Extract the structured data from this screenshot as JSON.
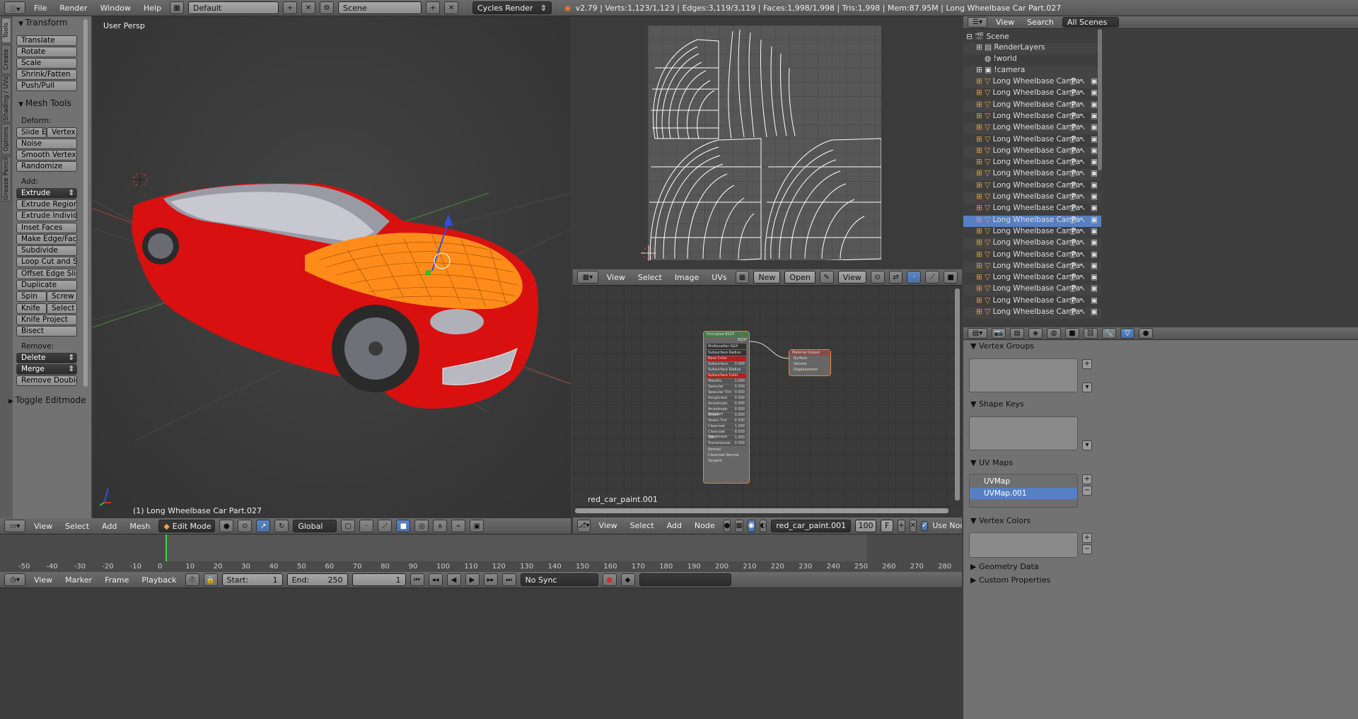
{
  "topbar": {
    "menus": [
      "File",
      "Render",
      "Window",
      "Help"
    ],
    "screen_layout": "Default",
    "scene": "Scene",
    "engine": "Cycles Render",
    "stats": "v2.79 | Verts:1,123/1,123 | Edges:3,119/3,119 | Faces:1,998/1,998 | Tris:1,998 | Mem:87.95M | Long Wheelbase Car Part.027"
  },
  "toolshelf": {
    "tabs": [
      "Tools",
      "Create",
      "Shading / UVs",
      "Options",
      "Grease Pencil"
    ],
    "transform": {
      "title": "Transform",
      "buttons": [
        "Translate",
        "Rotate",
        "Scale",
        "Shrink/Fatten",
        "Push/Pull"
      ]
    },
    "mesh_tools": {
      "title": "Mesh Tools",
      "deform_label": "Deform:",
      "slide_edge": "Slide Ed",
      "vertex": "Vertex",
      "noise": "Noise",
      "smooth_vertex": "Smooth Vertex",
      "randomize": "Randomize",
      "add_label": "Add:",
      "extrude": "Extrude",
      "extrude_region": "Extrude Region",
      "extrude_individual": "Extrude Individual",
      "inset_faces": "Inset Faces",
      "make_edge_face": "Make Edge/Face",
      "subdivide": "Subdivide",
      "loop_cut": "Loop Cut and Slide",
      "offset_edge": "Offset Edge Slide",
      "duplicate": "Duplicate",
      "spin": "Spin",
      "screw": "Screw",
      "knife": "Knife",
      "select": "Select",
      "knife_project": "Knife Project",
      "bisect": "Bisect",
      "remove_label": "Remove:",
      "delete": "Delete",
      "merge": "Merge",
      "remove_doubles": "Remove Doubles"
    },
    "toggle_editmode": "Toggle Editmode"
  },
  "viewport": {
    "label": "User Persp",
    "object_label": "(1) Long Wheelbase Car Part.027",
    "header": {
      "menus": [
        "View",
        "Select",
        "Add",
        "Mesh"
      ],
      "mode": "Edit Mode",
      "orientation": "Global"
    }
  },
  "uv_editor": {
    "header": {
      "menus": [
        "View",
        "Select",
        "Image",
        "UVs"
      ],
      "new": "New",
      "open": "Open",
      "view": "View"
    }
  },
  "node_editor": {
    "material_name": "red_car_paint.001",
    "principled": {
      "title": "Principled BSDF",
      "output": "BSDF",
      "distribution": "Multiscatter GGX",
      "subsurface_method": "Subsurface Radius",
      "fields": [
        [
          "Base Color",
          ""
        ],
        [
          "Subsurface",
          "0.000"
        ],
        [
          "Subsurface Radius",
          ""
        ],
        [
          "Subsurface Color",
          ""
        ],
        [
          "Metallic",
          "1.000"
        ],
        [
          "Specular",
          "0.500"
        ],
        [
          "Specular Tint",
          "0.000"
        ],
        [
          "Roughness",
          "0.500"
        ],
        [
          "Anisotropic",
          "0.000"
        ],
        [
          "Anisotropic Rotation",
          "0.000"
        ],
        [
          "Sheen",
          "0.000"
        ],
        [
          "Sheen Tint",
          "0.500"
        ],
        [
          "Clearcoat",
          "1.000"
        ],
        [
          "Clearcoat Roughness",
          "0.030"
        ],
        [
          "IOR",
          "1.450"
        ],
        [
          "Transmission",
          "0.000"
        ]
      ],
      "inputs": [
        "Normal",
        "Clearcoat Normal",
        "Tangent"
      ]
    },
    "output_node": {
      "title": "Material Output",
      "inputs": [
        "Surface",
        "Volume",
        "Displacement"
      ]
    },
    "header": {
      "menus": [
        "View",
        "Select",
        "Add",
        "Node"
      ],
      "material": "red_car_paint.001",
      "users": "100",
      "fake_user": "F",
      "use_nodes": "Use Nodes"
    }
  },
  "outliner": {
    "header": {
      "view": "View",
      "search": "Search",
      "scope": "All Scenes"
    },
    "scene": "Scene",
    "render_layers": "RenderLayers",
    "world": "!world",
    "camera": "!camera",
    "object_name": "Long Wheelbase Car Pa",
    "object_count": 21,
    "selected_index": 12
  },
  "properties": {
    "vertex_groups": "Vertex Groups",
    "shape_keys": "Shape Keys",
    "uv_maps": "UV Maps",
    "uv_map_items": [
      "UVMap",
      "UVMap.001"
    ],
    "vertex_colors": "Vertex Colors",
    "geometry_data": "Geometry Data",
    "custom_properties": "Custom Properties"
  },
  "timeline": {
    "ticks": [
      "-50",
      "-40",
      "-30",
      "-20",
      "-10",
      "0",
      "10",
      "20",
      "30",
      "40",
      "50",
      "60",
      "70",
      "80",
      "90",
      "100",
      "110",
      "120",
      "130",
      "140",
      "150",
      "160",
      "170",
      "180",
      "190",
      "200",
      "210",
      "220",
      "230",
      "240",
      "250",
      "260",
      "270",
      "280"
    ],
    "header": {
      "menus": [
        "View",
        "Marker",
        "Frame",
        "Playback"
      ],
      "start_label": "Start:",
      "start": "1",
      "end_label": "End:",
      "end": "250",
      "current": "1",
      "sync": "No Sync"
    }
  },
  "colors": {
    "car_red": "#d81010",
    "selection_orange": "#ff8c1a",
    "uv_active": "#5680c2"
  }
}
